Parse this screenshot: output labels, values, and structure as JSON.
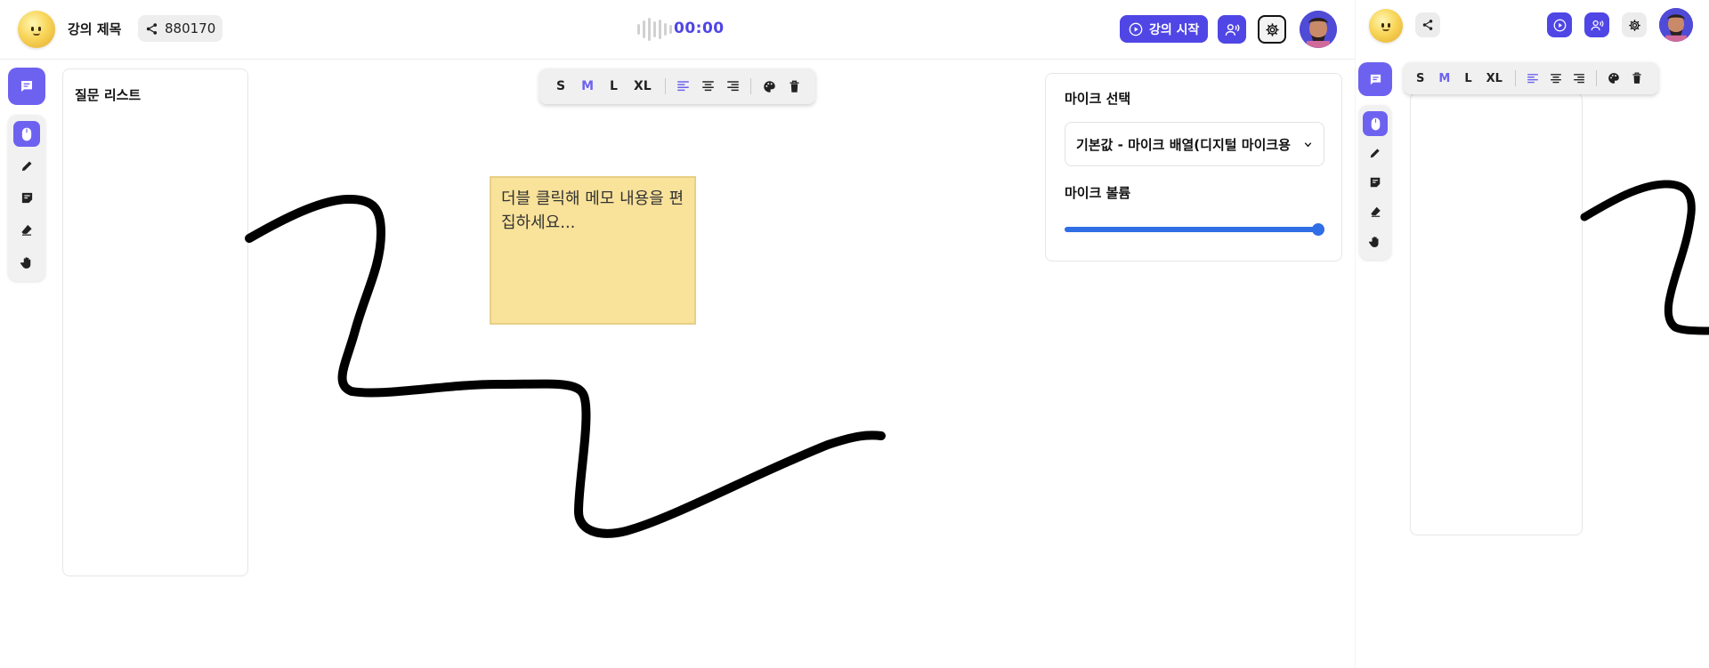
{
  "header": {
    "title": "강의 제목",
    "room_code": "880170",
    "timer": "00:00",
    "start_button_label": "강의 시작"
  },
  "question_panel": {
    "title": "질문 리스트"
  },
  "format_toolbar": {
    "sizes": [
      "S",
      "M",
      "L",
      "XL"
    ],
    "active_size": "M",
    "accent_color": "#6d62f0"
  },
  "sticky_note": {
    "text": "더블 클릭해 메모 내용을 편집하세요..."
  },
  "mic_panel": {
    "select_label": "마이크 선택",
    "selected_device": "기본값 - 마이크 배열(디지털 마이크용",
    "volume_label": "마이크 볼륨",
    "volume_level": 1.0
  },
  "mini_toolbar": {
    "sizes": [
      "S",
      "M",
      "L",
      "XL"
    ],
    "active_size": "M"
  },
  "colors": {
    "primary": "#4f46e5",
    "accent": "#6d62f0",
    "slider": "#2f6ee5",
    "note": "#f9e29a"
  },
  "icons": [
    "share-icon",
    "play-icon",
    "voice-icon",
    "gear-icon",
    "chat-icon",
    "mouse-icon",
    "pen-icon",
    "sticky-note-icon",
    "eraser-icon",
    "hand-icon",
    "align-left-icon",
    "align-center-icon",
    "align-right-icon",
    "palette-icon",
    "trash-icon",
    "chevron-down-icon"
  ]
}
